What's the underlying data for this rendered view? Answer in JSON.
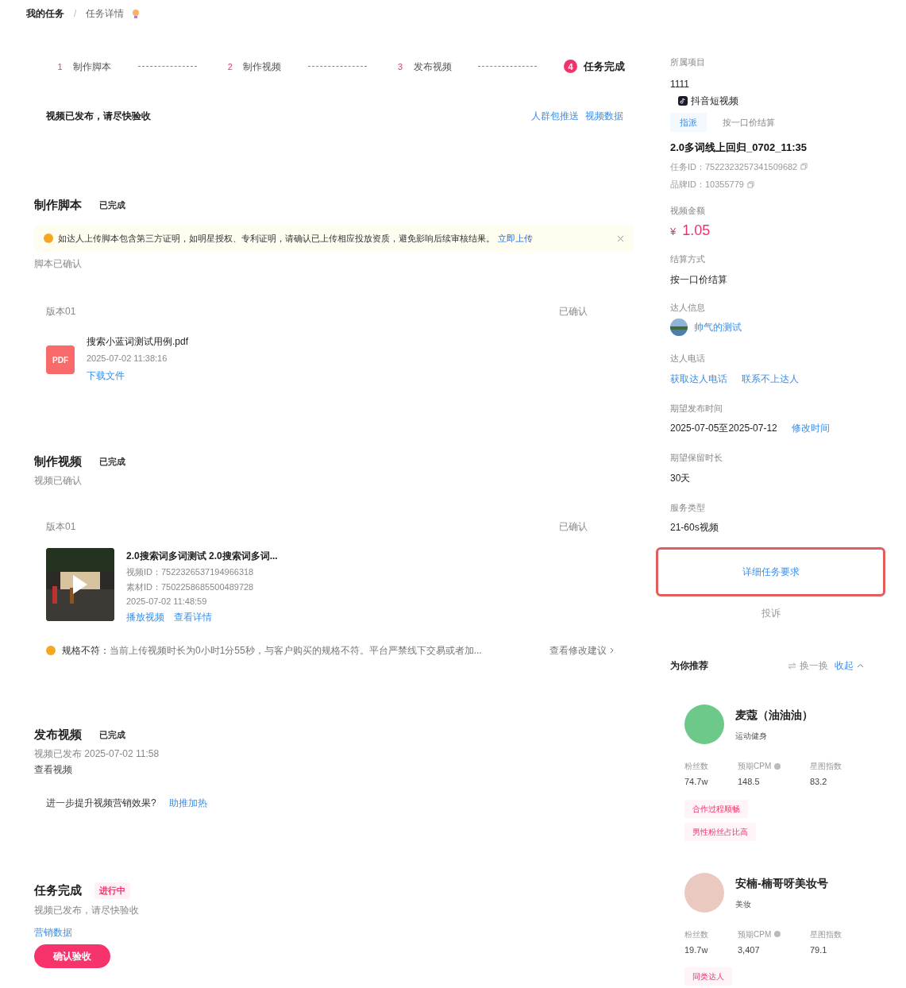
{
  "breadcrumb": {
    "items": [
      "我的任务",
      "任务详情"
    ],
    "separator": "/"
  },
  "steps": [
    {
      "number": "1",
      "label": "制作脚本",
      "selected": false
    },
    {
      "number": "2",
      "label": "制作视频",
      "selected": false
    },
    {
      "number": "3",
      "label": "发布视频",
      "selected": false
    },
    {
      "number": "4",
      "label": "任务完成",
      "selected": true
    }
  ],
  "banner": {
    "text": "视频已发布，请尽快验收",
    "links": [
      "人群包推送",
      "视频数据"
    ]
  },
  "script_section": {
    "title": "制作脚本",
    "status": {
      "text": "已完成",
      "kind": "done"
    },
    "alert": {
      "text": "如达人上传脚本包含第三方证明，如明星授权、专利证明，请确认已上传相应投放资质，避免影响后续审核结果。",
      "link": "立即上传"
    },
    "note": "脚本已确认",
    "version": "版本01",
    "version_status": "已确认",
    "file": {
      "badge": "PDF",
      "name": "搜索小蓝词测试用例.pdf",
      "time": "2025-07-02 11:38:16",
      "link": "下载文件"
    }
  },
  "video_section": {
    "title": "制作视频",
    "status": {
      "text": "已完成",
      "kind": "done"
    },
    "note": "视频已确认",
    "version": "版本01",
    "version_status": "已确认",
    "video": {
      "title": "2.0搜索词多词测试 2.0搜索词多词...",
      "video_id": "视频ID：7522326537194966318",
      "material_id": "素材ID：7502258685500489728",
      "time": "2025-07-02 11:48:59",
      "links": [
        "播放视频",
        "查看详情"
      ]
    },
    "warning": {
      "label": "规格不符：",
      "text": "当前上传视频时长为0小时1分55秒，与客户购买的规格不符。平台严禁线下交易或者加...",
      "link": "查看修改建议"
    }
  },
  "publish_section": {
    "title": "发布视频",
    "status": {
      "text": "已完成",
      "kind": "done"
    },
    "note": "视频已发布 2025-07-02 11:58",
    "view": "查看视频",
    "promo": "进一步提升视频营销效果?",
    "promo_link": "助推加热"
  },
  "complete_section": {
    "title": "任务完成",
    "status": {
      "text": "进行中",
      "kind": "progress"
    },
    "note": "视频已发布，请尽快验收",
    "link": "营销数据",
    "button": "确认验收"
  },
  "sidebar": {
    "project_label": "所属项目",
    "project": "1111",
    "platform": "抖音短视频",
    "tags": [
      "指派",
      "按一口价结算"
    ],
    "task_name": "2.0多词线上回归_0702_11:35",
    "task_id": "任务ID：7522323257341509682",
    "brand_id": "品牌ID：10355779",
    "amount_label": "视频金额",
    "currency": "¥",
    "amount": "1.05",
    "settle_label": "结算方式",
    "settle": "按一口价结算",
    "creator_label": "达人信息",
    "creator": "帅气的测试",
    "phone_label": "达人电话",
    "phone_links": [
      "获取达人电话",
      "联系不上达人"
    ],
    "publish_label": "期望发布时间",
    "publish_time": "2025-07-05至2025-07-12",
    "publish_link": "修改时间",
    "keep_label": "期望保留时长",
    "keep": "30天",
    "type_label": "服务类型",
    "type": "21-60s视频",
    "detail_button": "详细任务要求",
    "complain": "投诉"
  },
  "recommend": {
    "title": "为你推荐",
    "swap": "换一换",
    "collapse": "收起",
    "creators": [
      {
        "name": "麦蔻（油油油）",
        "category": "运动健身",
        "stats": [
          {
            "label": "粉丝数",
            "value": "74.7w"
          },
          {
            "label": "预期CPM",
            "value": "148.5",
            "help": true
          },
          {
            "label": "星图指数",
            "value": "83.2"
          }
        ],
        "tags": [
          "合作过程顺畅",
          "男性粉丝占比高"
        ],
        "color": "#6cc98a"
      },
      {
        "name": "安楠-楠哥呀美妆号",
        "category": "美妆",
        "stats": [
          {
            "label": "粉丝数",
            "value": "19.7w"
          },
          {
            "label": "预期CPM",
            "value": "3,407",
            "help": true
          },
          {
            "label": "星图指数",
            "value": "79.1"
          }
        ],
        "tags": [
          "同类达人"
        ],
        "color": "#e9c9c0"
      }
    ]
  }
}
